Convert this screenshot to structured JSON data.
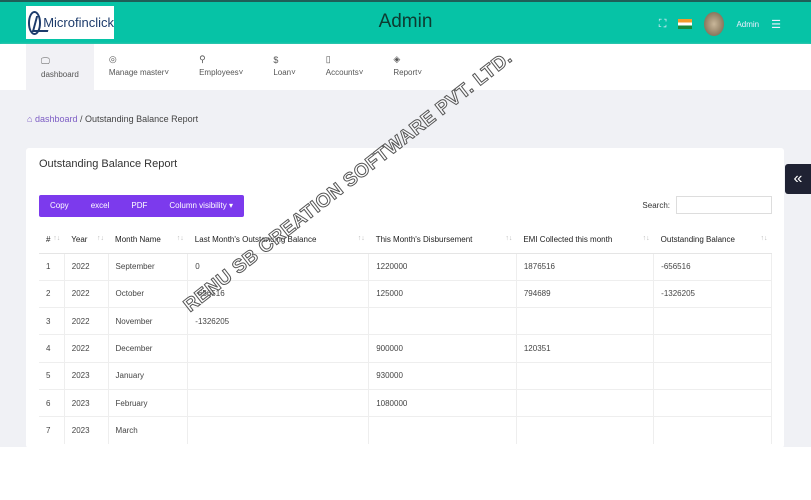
{
  "header": {
    "logo": "Microfinclick",
    "title": "Admin",
    "user": "Admin"
  },
  "nav": [
    {
      "icon": "monitor-icon",
      "label": "dashboard"
    },
    {
      "icon": "globe-icon",
      "label": "Manage master"
    },
    {
      "icon": "user-icon",
      "label": "Employees"
    },
    {
      "icon": "dollar-icon",
      "label": "Loan"
    },
    {
      "icon": "book-icon",
      "label": "Accounts"
    },
    {
      "icon": "layers-icon",
      "label": "Report"
    }
  ],
  "breadcrumb": {
    "home": "dashboard",
    "sep": "/",
    "current": "Outstanding Balance Report"
  },
  "card": {
    "title": "Outstanding Balance Report",
    "buttons": [
      "Copy",
      "excel",
      "PDF",
      "Column visibility ▾"
    ],
    "search_label": "Search:",
    "search_value": ""
  },
  "table": {
    "headers": [
      "#",
      "Year",
      "Month Name",
      "Last Month's Outstanding Balance",
      "This Month's Disbursement",
      "EMI Collected this month",
      "Outstanding Balance"
    ],
    "rows": [
      [
        "1",
        "2022",
        "September",
        "0",
        "1220000",
        "1876516",
        "-656516"
      ],
      [
        "2",
        "2022",
        "October",
        "-656516",
        "125000",
        "794689",
        "-1326205"
      ],
      [
        "3",
        "2022",
        "November",
        "-1326205",
        "",
        "",
        ""
      ],
      [
        "4",
        "2022",
        "December",
        "",
        "900000",
        "120351",
        ""
      ],
      [
        "5",
        "2023",
        "January",
        "",
        "930000",
        "",
        ""
      ],
      [
        "6",
        "2023",
        "February",
        "",
        "1080000",
        "",
        ""
      ],
      [
        "7",
        "2023",
        "March",
        "",
        "",
        "",
        ""
      ]
    ]
  },
  "watermark": "RENU SB CREATION SOFTWARE PVT. LTD.",
  "colors": {
    "header": "#06c3a6",
    "buttons": "#7c3aed",
    "link": "#7c5cc4"
  }
}
